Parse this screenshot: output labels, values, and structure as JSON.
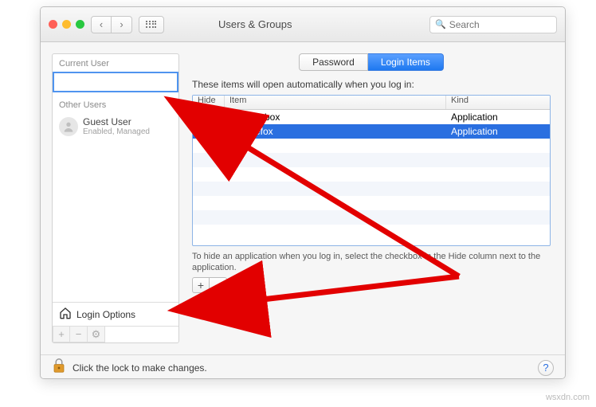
{
  "window": {
    "title": "Users & Groups"
  },
  "toolbar": {
    "search_placeholder": "Search"
  },
  "sidebar": {
    "current_label": "Current User",
    "other_label": "Other Users",
    "guest": {
      "name": "Guest User",
      "sub": "Enabled, Managed"
    },
    "login_options": "Login Options"
  },
  "tabs": {
    "password": "Password",
    "login_items": "Login Items"
  },
  "main": {
    "desc": "These items will open automatically when you log in:",
    "headers": {
      "hide": "Hide",
      "item": "Item",
      "kind": "Kind"
    },
    "rows": [
      {
        "name": "Dropbox",
        "kind": "Application",
        "selected": false
      },
      {
        "name": "Firefox",
        "kind": "Application",
        "selected": true
      }
    ],
    "note": "To hide an application when you log in, select the checkbox in the Hide column next to the application."
  },
  "footer": {
    "text": "Click the lock to make changes."
  },
  "watermark": "wsxdn.com"
}
